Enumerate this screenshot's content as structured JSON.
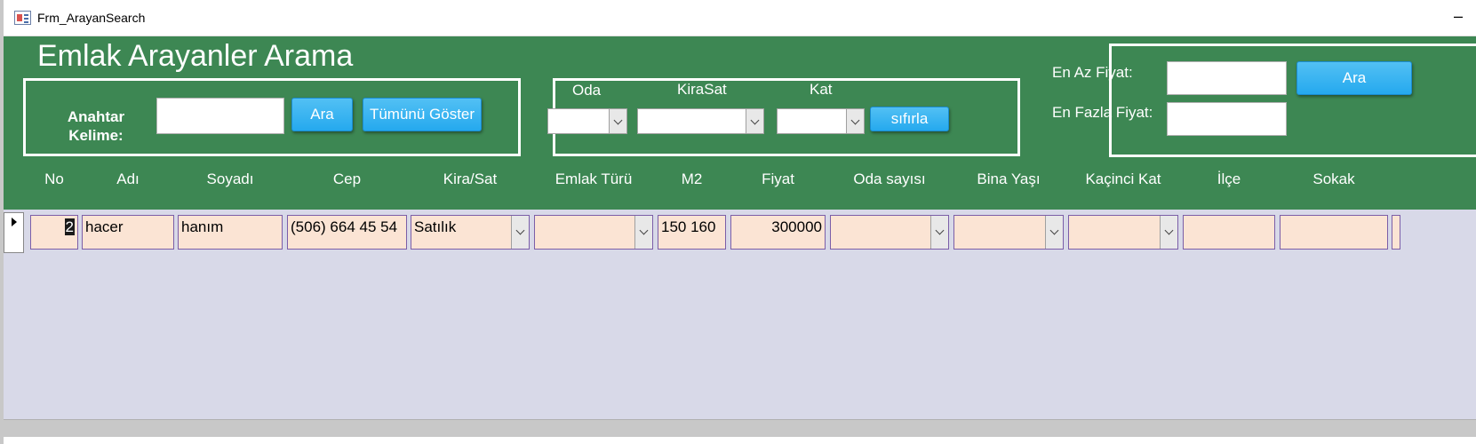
{
  "window": {
    "title": "Frm_ArayanSearch",
    "minimize": "–"
  },
  "form": {
    "title": "Emlak Arayanler Arama"
  },
  "search": {
    "keyword_label": "Anahtar\nKelime:",
    "keyword_value": "",
    "ara_button": "Ara",
    "show_all_button": "Tümünü Göster"
  },
  "filters": {
    "oda_label": "Oda",
    "kirasat_label": "KiraSat",
    "kat_label": "Kat",
    "oda_value": "",
    "kirasat_value": "",
    "kat_value": "",
    "reset_button": "sıfırla"
  },
  "price": {
    "min_label": "En Az Fiyat:",
    "max_label": "En Fazla Fiyat:",
    "min_value": "",
    "max_value": "",
    "ara_button": "Ara"
  },
  "columns": [
    "No",
    "Adı",
    "Soyadı",
    "Cep",
    "Kira/Sat",
    "Emlak Türü",
    "M2",
    "Fiyat",
    "Oda sayısı",
    "Bina Yaşı",
    "Kaçinci Kat",
    "İlçe",
    "Sokak"
  ],
  "rows": [
    {
      "no": "2",
      "adi": "hacer",
      "soyadi": "hanım",
      "cep": "(506) 664 45 54",
      "kira_sat": "Satılık",
      "emlak_turu": "",
      "m2": "150 160",
      "fiyat": "300000",
      "oda_sayisi": "",
      "bina_yasi": "",
      "kacinci_kat": "",
      "ilce": "",
      "sokak": ""
    }
  ],
  "colors": {
    "header_bg": "#3d8753",
    "button_bg": "#25a9ee",
    "cell_bg": "#fbe4d4",
    "detail_bg": "#d8d9e8"
  }
}
